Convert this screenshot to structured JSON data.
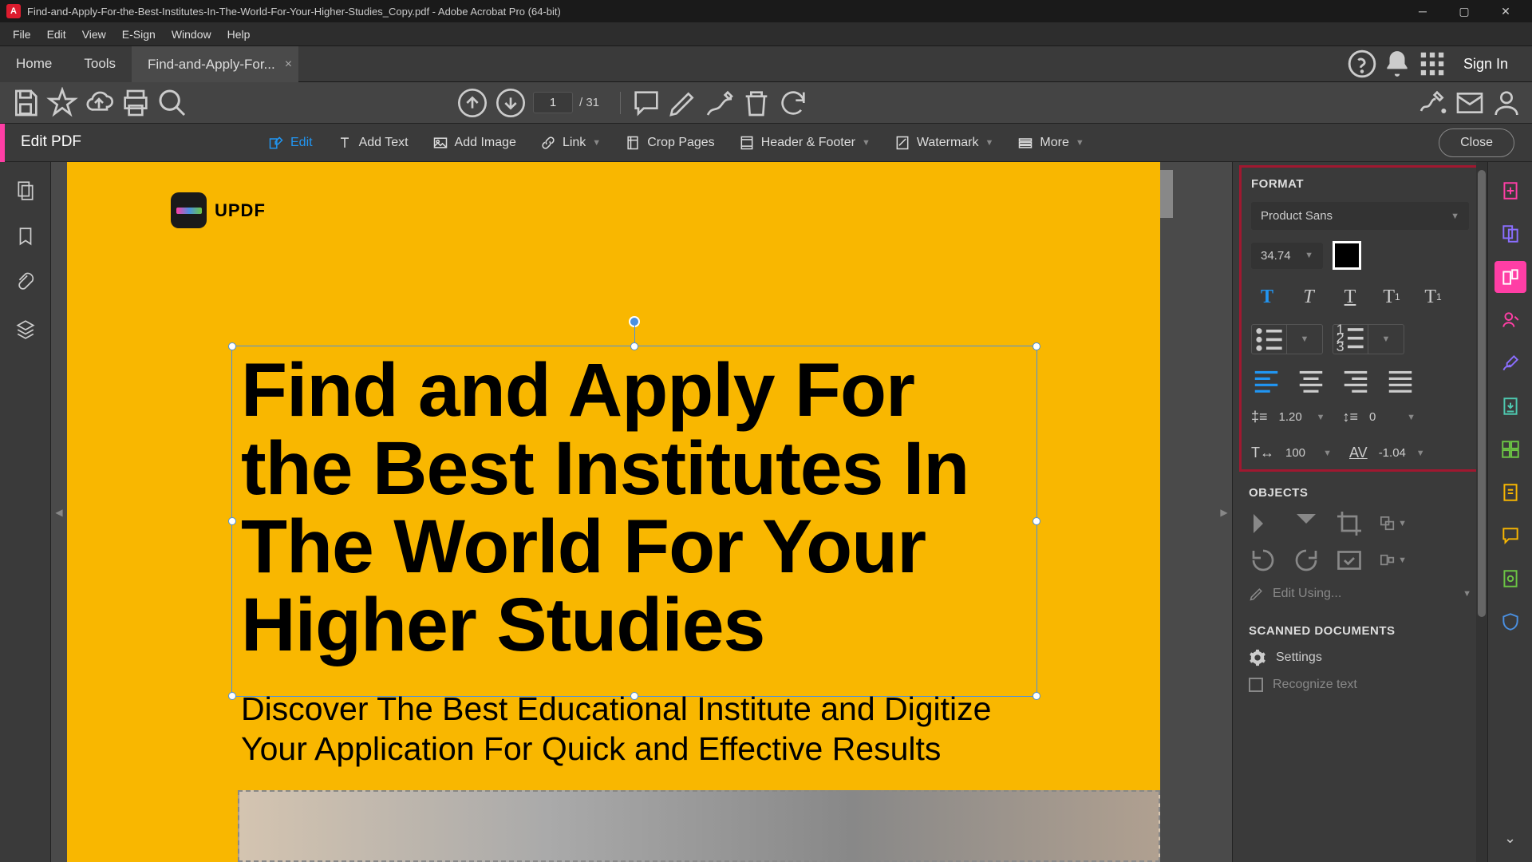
{
  "title_bar": {
    "text": "Find-and-Apply-For-the-Best-Institutes-In-The-World-For-Your-Higher-Studies_Copy.pdf - Adobe Acrobat Pro (64-bit)"
  },
  "menu": [
    "File",
    "Edit",
    "View",
    "E-Sign",
    "Window",
    "Help"
  ],
  "tabs": {
    "home": "Home",
    "tools": "Tools",
    "doc": "Find-and-Apply-For...",
    "sign_in": "Sign In"
  },
  "page_nav": {
    "current": "1",
    "total": "/ 31"
  },
  "edit_bar": {
    "title": "Edit PDF",
    "edit": "Edit",
    "add_text": "Add Text",
    "add_image": "Add Image",
    "link": "Link",
    "crop_pages": "Crop Pages",
    "header_footer": "Header & Footer",
    "watermark": "Watermark",
    "more": "More",
    "close": "Close"
  },
  "doc": {
    "logo_text": "UPDF",
    "heading": "Find and Apply For the Best Institutes In The World For Your Higher Studies",
    "subheading": "Discover The Best Educational Institute and Digitize Your Application For Quick and Effective Results"
  },
  "format_panel": {
    "title": "FORMAT",
    "font": "Product Sans",
    "size": "34.74",
    "line_height": "1.20",
    "para_spacing": "0",
    "hscale": "100",
    "char_spacing": "-1.04"
  },
  "objects_panel": {
    "title": "OBJECTS",
    "edit_using": "Edit Using..."
  },
  "scanned_panel": {
    "title": "SCANNED DOCUMENTS",
    "settings": "Settings",
    "recognize": "Recognize text"
  }
}
